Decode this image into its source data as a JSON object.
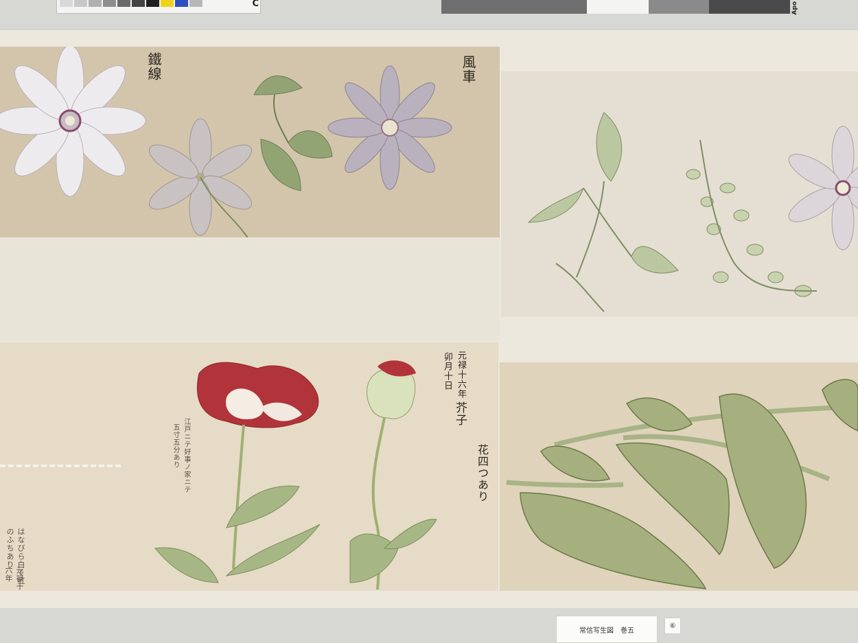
{
  "calibration": {
    "color_patches": [
      "#d9d9d9",
      "#c8c8c8",
      "#b0b0b0",
      "#8e8e8e",
      "#6a6a6a",
      "#434343",
      "#1f1f1f",
      "#f1d21b",
      "#2d4fbf",
      "#b8b8b8"
    ],
    "color_letter": "C",
    "gray_steps": [
      "#6e6e6e",
      "#f4f4f2",
      "#8a8a8a",
      "#4a4a4a"
    ],
    "gray_letter": "Apo"
  },
  "panels": {
    "clematis_top": {
      "caption_left": "鐵線",
      "caption_right": "風車"
    },
    "poppy": {
      "date": "元禄十六年",
      "date_line2": "卯月十日",
      "name": "芥子",
      "note_right": "花四つあり",
      "note_mid": "江戸ニテ好事ノ家ニテ",
      "note_mid2": "五寸五分あり",
      "note_left": "はなびら白く紅のふちあり",
      "note_left2": "元禄十六年"
    }
  },
  "label": {
    "title": "常信写生図",
    "volume": "巻五",
    "number": "⑥"
  },
  "colors": {
    "paper_dark": "#d3c6ad",
    "paper_light": "#e8e3d7",
    "poppy_red": "#b1343a",
    "leaf_green": "#9aab78",
    "clematis_petal": "#e9e6ea"
  }
}
